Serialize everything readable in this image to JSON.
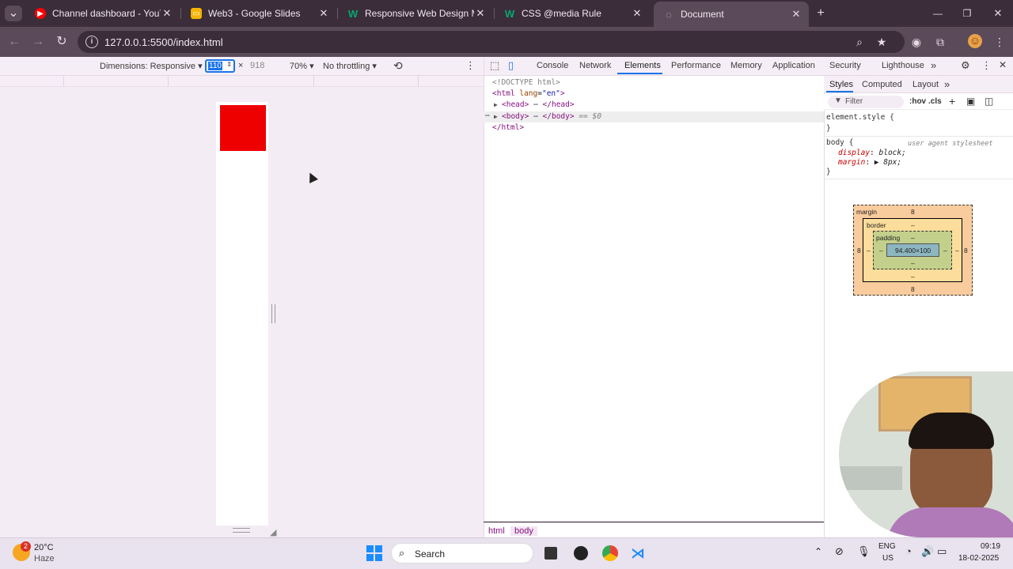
{
  "tabs": [
    {
      "title": "Channel dashboard - YouTube S",
      "fav_color": "#ff0000",
      "fav_glyph": "▶"
    },
    {
      "title": "Web3 - Google Slides",
      "fav_color": "#f4b400",
      "fav_glyph": "▭"
    },
    {
      "title": "Responsive Web Design Media",
      "fav_color": "#04aa6d",
      "fav_glyph": "W"
    },
    {
      "title": "CSS @media Rule",
      "fav_color": "#04aa6d",
      "fav_glyph": "W"
    },
    {
      "title": "Document",
      "fav_color": "#6b5b69",
      "fav_glyph": "◌"
    }
  ],
  "new_tab": "+",
  "window_controls": {
    "minimize": "—",
    "restore": "❐",
    "close": "✕"
  },
  "address": {
    "url": "127.0.0.1:5500/index.html"
  },
  "device_toolbar": {
    "dimensions": "Dimensions: Responsive ▾",
    "width": "110",
    "times": "×",
    "height": "918",
    "zoom": "70% ▾",
    "throttle": "No throttling ▾"
  },
  "devtools": {
    "tabs": [
      "Console",
      "Network",
      "Elements",
      "Performance",
      "Memory",
      "Application",
      "Security",
      "Lighthouse"
    ],
    "more": "»",
    "dom": {
      "doctype": "<!DOCTYPE html>",
      "html_open": "<html",
      "lang_attr": "lang",
      "lang_val": "\"en\"",
      "html_close_tag": ">",
      "head": "<head>",
      "head_ellipsis": "⋯",
      "head_close": "</head>",
      "body": "<body>",
      "body_ellipsis": "⋯",
      "body_close": "</body>",
      "selected_marker": "== $0",
      "html_end": "</html>"
    },
    "breadcrumbs": [
      "html",
      "body"
    ],
    "styles_tabs": [
      "Styles",
      "Computed",
      "Layout"
    ],
    "filter_placeholder": "Filter",
    "hov": ":hov",
    "cls": ".cls",
    "rules": {
      "element_style": "element.style {",
      "close1": "}",
      "body_selector": "body {",
      "ua_label": "user agent stylesheet",
      "prop1": "display",
      "val1": "block;",
      "prop2": "margin",
      "val2": "▶ 8px;",
      "close2": "}"
    },
    "box_model": {
      "margin_label": "margin",
      "margin_top": "8",
      "margin_bottom": "8",
      "margin_left": "8",
      "margin_right": "8",
      "border_label": "border",
      "border_top": "–",
      "border_bottom": "–",
      "border_left": "–",
      "border_right": "–",
      "padding_label": "padding",
      "padding_top": "–",
      "padding_bottom": "–",
      "padding_left": "–",
      "padding_right": "–",
      "content": "94.400×100"
    }
  },
  "taskbar": {
    "temperature": "20°C",
    "weather": "Haze",
    "weather_badge": "2",
    "search": "Search",
    "lang_line1": "ENG",
    "lang_line2": "US",
    "time": "09:19",
    "date": "18-02-2025"
  }
}
